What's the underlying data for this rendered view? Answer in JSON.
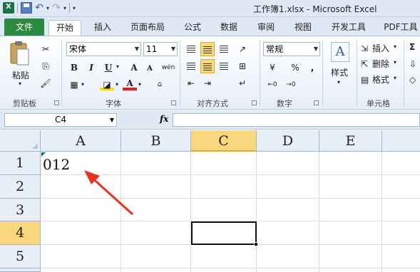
{
  "window": {
    "title": "工作簿1.xlsx - Microsoft Excel"
  },
  "tabs": {
    "file": "文件",
    "home": "开始",
    "insert": "插入",
    "layout": "页面布局",
    "formulas": "公式",
    "data": "数据",
    "review": "审阅",
    "view": "视图",
    "developer": "开发工具",
    "pdf": "PDF工具"
  },
  "clipboard": {
    "paste": "粘贴",
    "label": "剪贴板"
  },
  "font": {
    "name": "宋体",
    "size": "11",
    "label": "字体",
    "bold": "B",
    "italic": "I",
    "underline": "U",
    "grow": "A",
    "shrink": "A",
    "fontcolor": "A",
    "phonetic": "wén"
  },
  "alignment": {
    "label": "对齐方式"
  },
  "number": {
    "format": "常规",
    "percent": "%",
    "comma": ",",
    "label": "数字"
  },
  "styles": {
    "label": "样式"
  },
  "cells": {
    "insert": "插入",
    "delete": "删除",
    "format": "格式",
    "label": "单元格"
  },
  "formula_bar": {
    "name_box": "C4",
    "fx": "fx",
    "value": ""
  },
  "columns": [
    "A",
    "B",
    "C",
    "D",
    "E"
  ],
  "rows": [
    "1",
    "2",
    "3",
    "4",
    "5"
  ],
  "cells_data": {
    "A1": "012"
  },
  "selected_cell": "C4",
  "colors": {
    "file_tab": "#2a8a3e",
    "selected_header": "#f8d77d",
    "annotation_arrow": "#e8321e"
  }
}
